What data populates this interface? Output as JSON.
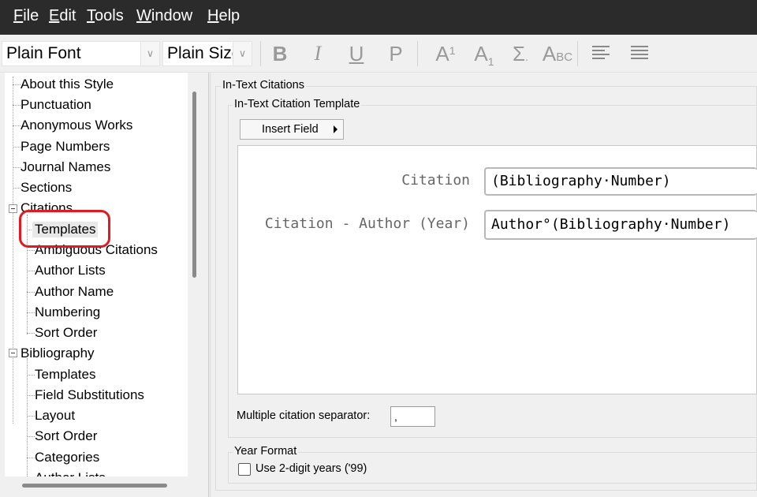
{
  "menu": [
    {
      "label": "File",
      "u": "F",
      "rest": "ile"
    },
    {
      "label": "Edit",
      "u": "E",
      "rest": "dit"
    },
    {
      "label": "Tools",
      "u": "T",
      "rest": "ools"
    },
    {
      "label": "Window",
      "u": "W",
      "rest": "indow"
    },
    {
      "label": "Help",
      "u": "H",
      "rest": "elp"
    }
  ],
  "toolbar": {
    "font_value": "Plain Font",
    "size_value": "Plain Size",
    "bold": "B",
    "italic": "I",
    "underline": "U",
    "plain": "P",
    "superscript": "A",
    "superscript_sup": "1",
    "subscript": "A",
    "subscript_sub": "1",
    "symbol": "Σ",
    "symbol_dot": ".",
    "smallcaps_a": "A",
    "smallcaps_bc": "BC"
  },
  "tree": {
    "items": [
      "About this Style",
      "Punctuation",
      "Anonymous Works",
      "Page Numbers",
      "Journal Names",
      "Sections",
      "Citations",
      "Templates",
      "Ambiguous Citations",
      "Author Lists",
      "Author Name",
      "Numbering",
      "Sort Order",
      "Bibliography",
      "Templates",
      "Field Substitutions",
      "Layout",
      "Sort Order",
      "Categories",
      "Author Lists"
    ],
    "selected": "Templates"
  },
  "panel": {
    "group_title": "In-Text Citations",
    "template_group_title": "In-Text Citation Template",
    "insert_field_label": "Insert Field",
    "rows": [
      {
        "label": "Citation",
        "value": "(Bibliography·Number)"
      },
      {
        "label": "Citation - Author (Year)",
        "value": "Author°(Bibliography·Number)"
      }
    ],
    "separator_label": "Multiple citation separator:",
    "separator_value": ",",
    "year_group_title": "Year Format",
    "two_digit_label": "Use 2-digit years ('99)",
    "two_digit_checked": false
  },
  "colors": {
    "menubar_bg": "#2b2b2b",
    "annotation_circle": "#e4181f"
  }
}
